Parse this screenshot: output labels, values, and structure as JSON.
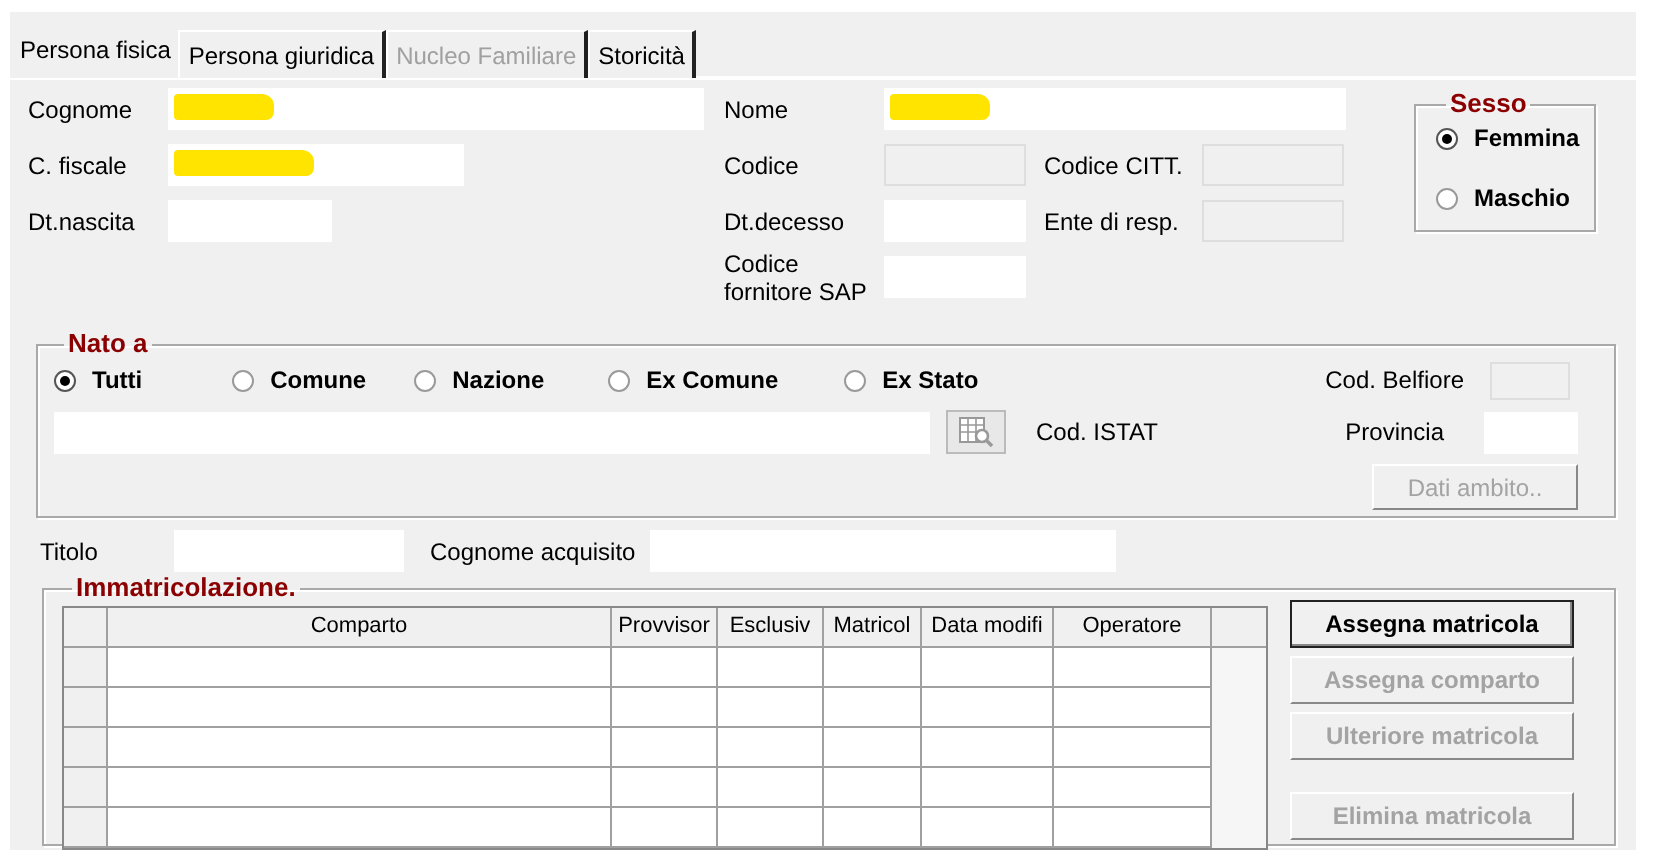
{
  "tabs": [
    {
      "label": "Persona fisica",
      "selected": true,
      "disabled": false
    },
    {
      "label": "Persona giuridica",
      "selected": false,
      "disabled": false
    },
    {
      "label": "Nucleo Familiare",
      "selected": false,
      "disabled": true
    },
    {
      "label": "Storicità",
      "selected": false,
      "disabled": false
    }
  ],
  "fields": [
    {
      "label": "Cognome",
      "highlighted": true,
      "disabled": false
    },
    {
      "label": "Nome",
      "highlighted": true,
      "disabled": false
    },
    {
      "label": "C. fiscale",
      "highlighted": true,
      "disabled": false
    },
    {
      "label": "Codice",
      "highlighted": false,
      "disabled": true
    },
    {
      "label": "Codice CITT.",
      "highlighted": false,
      "disabled": true
    },
    {
      "label": "Dt.nascita",
      "highlighted": false,
      "disabled": false
    },
    {
      "label": "Dt.decesso",
      "highlighted": false,
      "disabled": false
    },
    {
      "label": "Ente di resp.",
      "highlighted": false,
      "disabled": true
    },
    {
      "label": "Codice fornitore SAP",
      "highlighted": false,
      "disabled": false
    }
  ],
  "sesso": {
    "title": "Sesso",
    "options": [
      {
        "label": "Femmina",
        "selected": true
      },
      {
        "label": "Maschio",
        "selected": false
      }
    ]
  },
  "nato_a": {
    "title": "Nato a",
    "options": [
      {
        "label": "Tutti",
        "selected": true
      },
      {
        "label": "Comune",
        "selected": false
      },
      {
        "label": "Nazione",
        "selected": false
      },
      {
        "label": "Ex Comune",
        "selected": false
      },
      {
        "label": "Ex Stato",
        "selected": false
      }
    ],
    "cod_belfiore": {
      "label": "Cod. Belfiore",
      "disabled": true
    },
    "lookup_button": {
      "disabled": true
    },
    "cod_istat_label": "Cod. ISTAT",
    "provincia": {
      "label": "Provincia",
      "disabled": false
    },
    "dati_ambito": {
      "label": "Dati ambito..",
      "disabled": true
    }
  },
  "extra_fields": [
    {
      "label": "Titolo"
    },
    {
      "label": "Cognome acquisito"
    }
  ],
  "immatricolazione": {
    "title": "Immatricolazione.",
    "columns": [
      "Comparto",
      "Provvisor",
      "Esclusiv",
      "Matricol",
      "Data modifi",
      "Operatore"
    ],
    "buttons": [
      {
        "label": "Assegna matricola",
        "disabled": false,
        "default": true
      },
      {
        "label": "Assegna comparto",
        "disabled": true,
        "default": false
      },
      {
        "label": "Ulteriore matricola",
        "disabled": true,
        "default": false
      },
      {
        "label": "Elimina matricola",
        "disabled": true,
        "default": false
      }
    ]
  }
}
